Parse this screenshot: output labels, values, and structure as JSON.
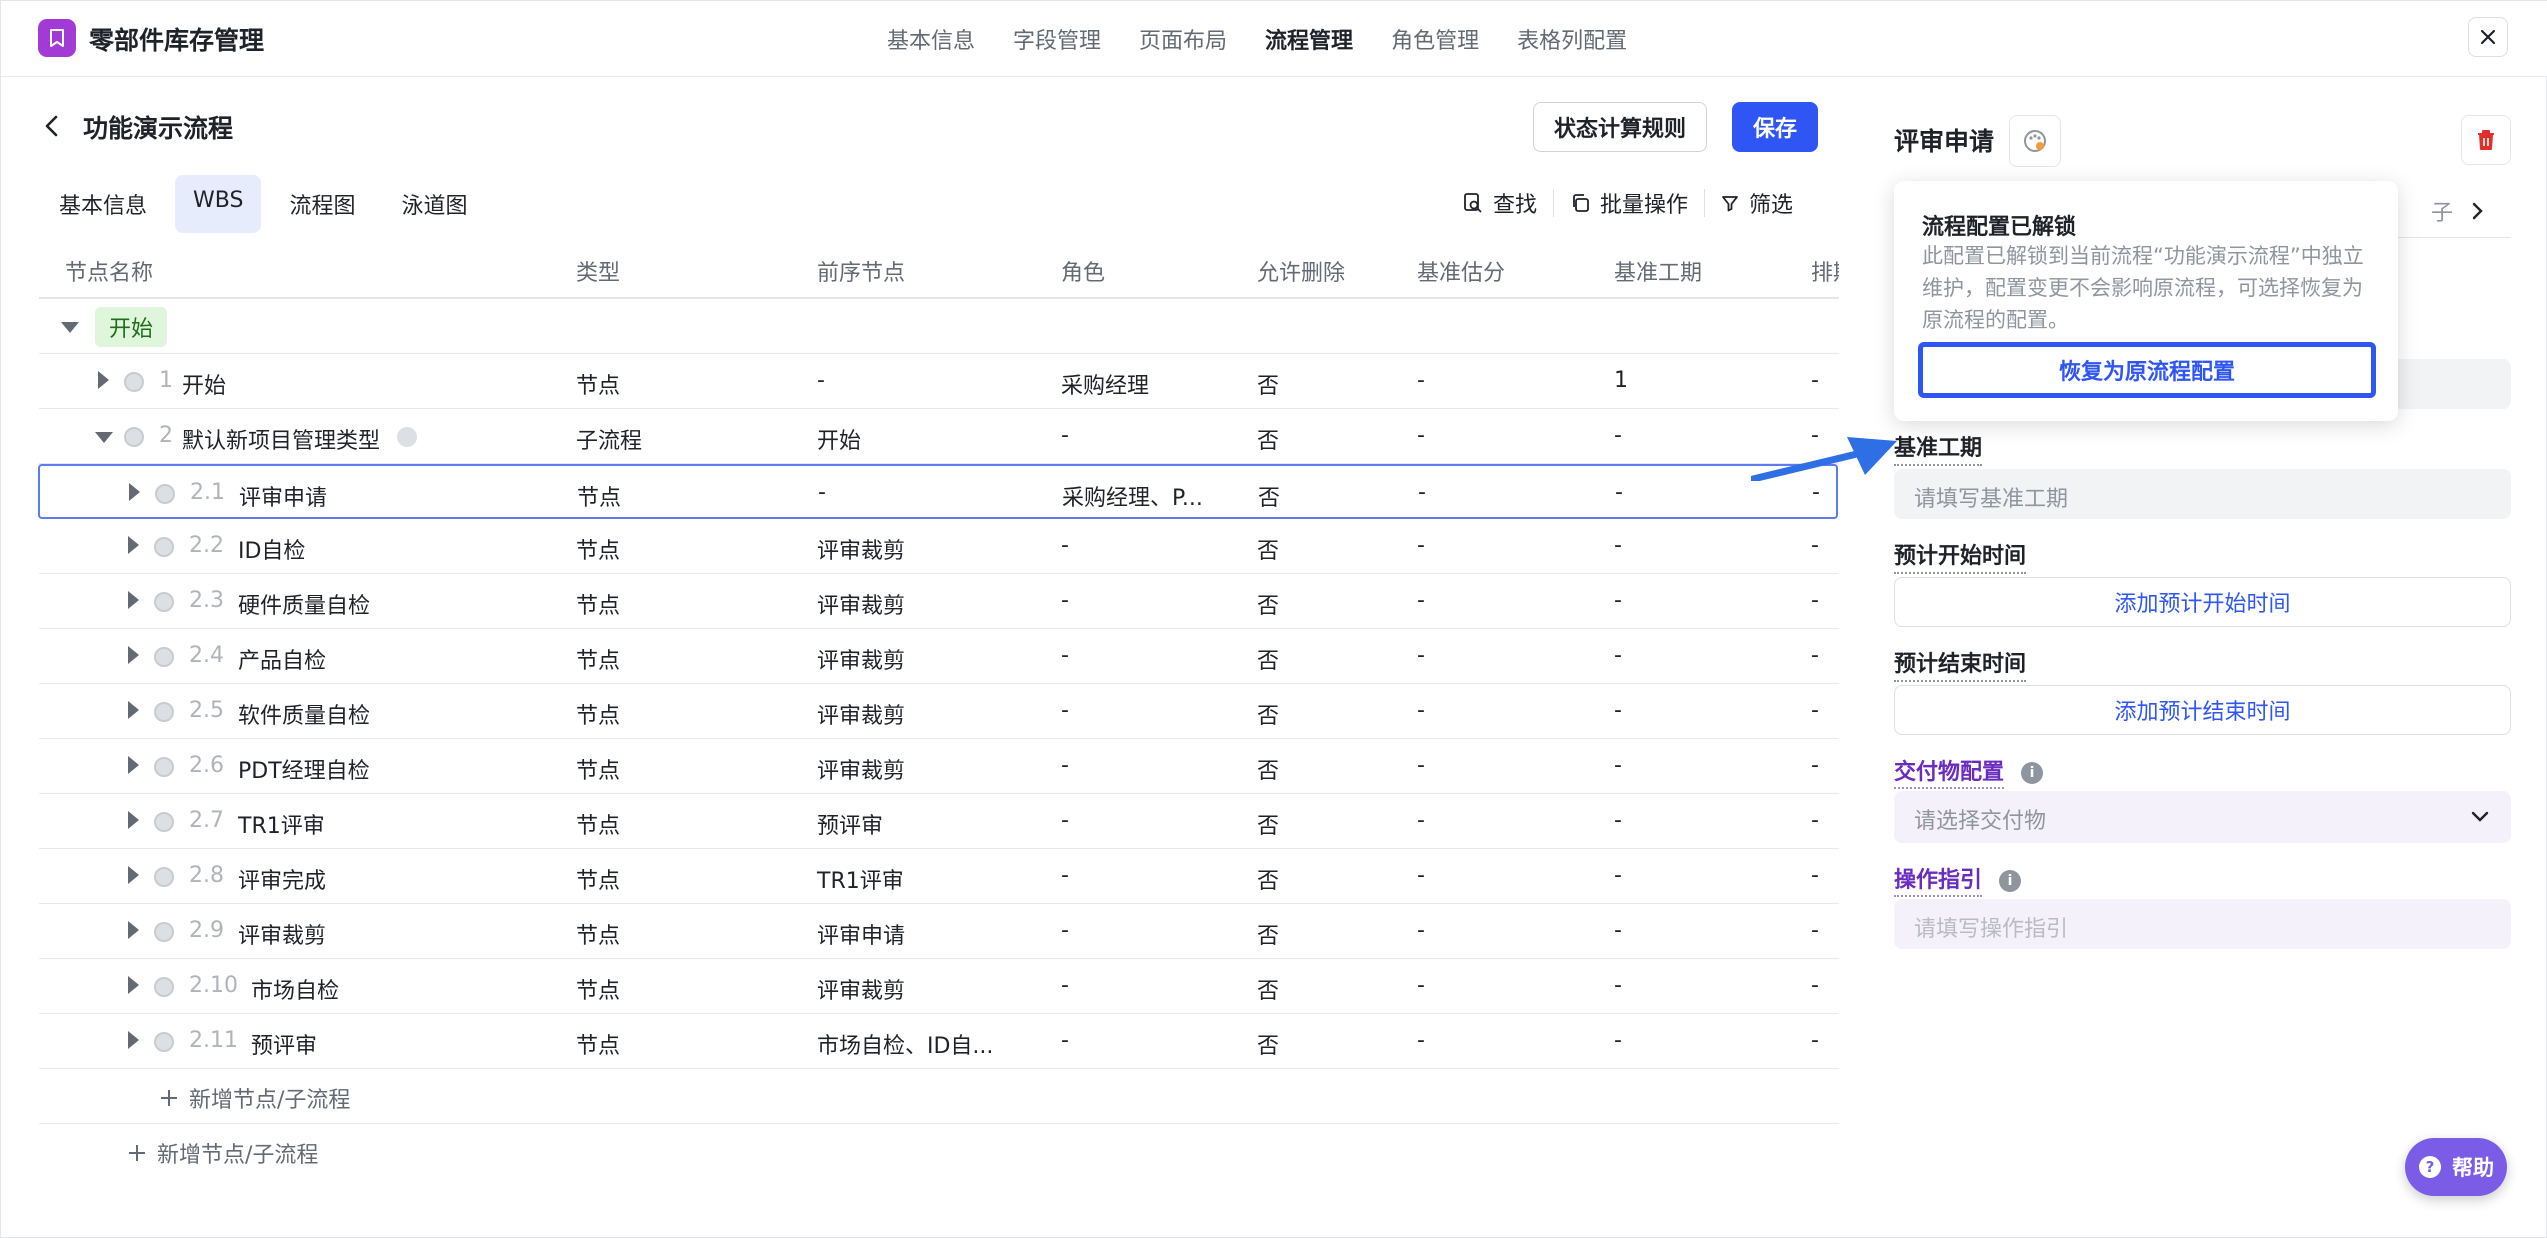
{
  "app": {
    "title": "零部件库存管理"
  },
  "top_nav": [
    "基本信息",
    "字段管理",
    "页面布局",
    "流程管理",
    "角色管理",
    "表格列配置"
  ],
  "page": {
    "title": "功能演示流程",
    "rule_button": "状态计算规则",
    "save_button": "保存"
  },
  "sub_tabs": [
    "基本信息",
    "WBS",
    "流程图",
    "泳道图"
  ],
  "toolbar": {
    "find": "查找",
    "batch": "批量操作",
    "filter": "筛选"
  },
  "table": {
    "headers": [
      "节点名称",
      "类型",
      "前序节点",
      "角色",
      "允许删除",
      "基准估分",
      "基准工期",
      "排期"
    ],
    "group_tag": "开始",
    "rows": [
      {
        "num": "1",
        "name": "开始",
        "type": "节点",
        "prev": "-",
        "role": "采购经理",
        "del": "否",
        "score": "-",
        "dur": "1",
        "sched": "-"
      },
      {
        "num": "2",
        "name": "默认新项目管理类型",
        "type": "子流程",
        "prev": "开始",
        "role": "-",
        "del": "否",
        "score": "-",
        "dur": "-",
        "sched": "-"
      },
      {
        "num": "2.1",
        "name": "评审申请",
        "type": "节点",
        "prev": "-",
        "role": "采购经理、P...",
        "del": "否",
        "score": "-",
        "dur": "-",
        "sched": "-"
      },
      {
        "num": "2.2",
        "name": "ID自检",
        "type": "节点",
        "prev": "评审裁剪",
        "role": "-",
        "del": "否",
        "score": "-",
        "dur": "-",
        "sched": "-"
      },
      {
        "num": "2.3",
        "name": "硬件质量自检",
        "type": "节点",
        "prev": "评审裁剪",
        "role": "-",
        "del": "否",
        "score": "-",
        "dur": "-",
        "sched": "-"
      },
      {
        "num": "2.4",
        "name": "产品自检",
        "type": "节点",
        "prev": "评审裁剪",
        "role": "-",
        "del": "否",
        "score": "-",
        "dur": "-",
        "sched": "-"
      },
      {
        "num": "2.5",
        "name": "软件质量自检",
        "type": "节点",
        "prev": "评审裁剪",
        "role": "-",
        "del": "否",
        "score": "-",
        "dur": "-",
        "sched": "-"
      },
      {
        "num": "2.6",
        "name": "PDT经理自检",
        "type": "节点",
        "prev": "评审裁剪",
        "role": "-",
        "del": "否",
        "score": "-",
        "dur": "-",
        "sched": "-"
      },
      {
        "num": "2.7",
        "name": "TR1评审",
        "type": "节点",
        "prev": "预评审",
        "role": "-",
        "del": "否",
        "score": "-",
        "dur": "-",
        "sched": "-"
      },
      {
        "num": "2.8",
        "name": "评审完成",
        "type": "节点",
        "prev": "TR1评审",
        "role": "-",
        "del": "否",
        "score": "-",
        "dur": "-",
        "sched": "-"
      },
      {
        "num": "2.9",
        "name": "评审裁剪",
        "type": "节点",
        "prev": "评审申请",
        "role": "-",
        "del": "否",
        "score": "-",
        "dur": "-",
        "sched": "-"
      },
      {
        "num": "2.10",
        "name": "市场自检",
        "type": "节点",
        "prev": "评审裁剪",
        "role": "-",
        "del": "否",
        "score": "-",
        "dur": "-",
        "sched": "-"
      },
      {
        "num": "2.11",
        "name": "预评审",
        "type": "节点",
        "prev": "市场自检、ID自...",
        "role": "-",
        "del": "否",
        "score": "-",
        "dur": "-",
        "sched": "-"
      }
    ],
    "add_child": "新增节点/子流程",
    "add_root": "新增节点/子流程"
  },
  "panel": {
    "title": "评审申请",
    "tab_partial": "子",
    "popover": {
      "title": "流程配置已解锁",
      "desc": "此配置已解锁到当前流程“功能演示流程”中独立维护，配置变更不会影响原流程，可选择恢复为原流程的配置。",
      "button": "恢复为原流程配置"
    },
    "duration_label": "基准工期",
    "duration_placeholder": "请填写基准工期",
    "start_label": "预计开始时间",
    "start_button": "添加预计开始时间",
    "end_label": "预计结束时间",
    "end_button": "添加预计结束时间",
    "deliverable_label": "交付物配置",
    "deliverable_placeholder": "请选择交付物",
    "guide_label": "操作指引",
    "guide_placeholder": "请填写操作指引"
  },
  "help": "帮助",
  "colors": {
    "primary": "#2f56f5",
    "purple": "#6a2bbf",
    "logo": "#a23bd6",
    "danger": "#e0302b"
  }
}
